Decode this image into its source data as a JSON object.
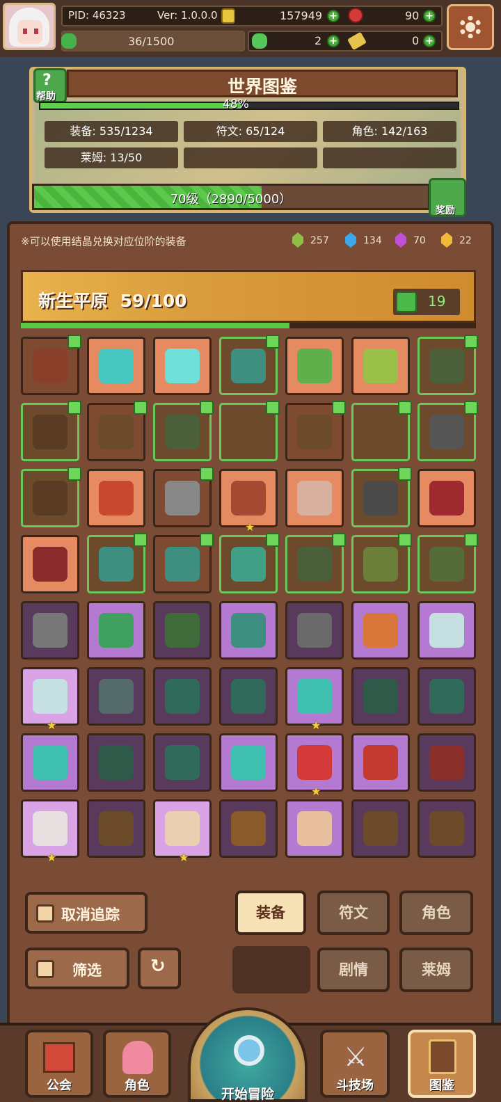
{
  "top": {
    "pid": "PID: 46323",
    "version": "Ver: 1.0.0.0",
    "gold": "157949",
    "gems": "90",
    "energy": "36/1500",
    "clover": "2",
    "ticket": "0"
  },
  "world": {
    "title": "世界图鉴",
    "help_label": "帮助",
    "percent_text": "48%",
    "percent_value": 0.48,
    "stats": [
      "装备: 535/1234",
      "符文: 65/124",
      "角色: 142/163",
      "莱姆: 13/50"
    ],
    "level_text": "70级（2890/5000）",
    "level_progress": 0.578,
    "reward_label": "奖励"
  },
  "hint": "※可以使用结晶兑换对应位阶的装备",
  "crystals": [
    {
      "name": "green-crystal",
      "color": "#8fbd45",
      "count": "257"
    },
    {
      "name": "blue-crystal",
      "color": "#3aa8ea",
      "count": "134"
    },
    {
      "name": "purple-crystal",
      "color": "#c04ed6",
      "count": "70"
    },
    {
      "name": "gold-crystal",
      "color": "#f2b83a",
      "count": "22"
    }
  ],
  "zone": {
    "name": "新生平原",
    "progress": "59/100",
    "progress_value": 0.59,
    "likes": "19"
  },
  "items": [
    {
      "tier": "brown",
      "color": "#8a3f2a",
      "thumb": true
    },
    {
      "tier": "orange",
      "color": "#47c7c0",
      "thumb": false
    },
    {
      "tier": "orange",
      "color": "#6fe0d8",
      "thumb": false
    },
    {
      "tier": "green",
      "color": "#3f8f80",
      "thumb": true
    },
    {
      "tier": "orange",
      "color": "#5fb04a",
      "thumb": false
    },
    {
      "tier": "orange",
      "color": "#9bc04a",
      "thumb": false
    },
    {
      "tier": "green",
      "color": "#4a5f3a",
      "thumb": true
    },
    {
      "tier": "green",
      "color": "#5a3c25",
      "thumb": true
    },
    {
      "tier": "brown",
      "color": "#6b4b2a",
      "thumb": true
    },
    {
      "tier": "green",
      "color": "#4a5f3a",
      "thumb": true
    },
    {
      "tier": "green",
      "color": "#6b4b2a",
      "thumb": true
    },
    {
      "tier": "brown",
      "color": "#6b4b2a",
      "thumb": true
    },
    {
      "tier": "green",
      "color": "#6b4b2a",
      "thumb": true
    },
    {
      "tier": "green",
      "color": "#555555",
      "thumb": true
    },
    {
      "tier": "green",
      "color": "#5a3c25",
      "thumb": true
    },
    {
      "tier": "orange",
      "color": "#c7472f",
      "thumb": false
    },
    {
      "tier": "brown",
      "color": "#888888",
      "thumb": true
    },
    {
      "tier": "orange",
      "color": "#a44a33",
      "thumb": false,
      "star": true
    },
    {
      "tier": "orange",
      "color": "#d8b0a0",
      "thumb": false
    },
    {
      "tier": "green",
      "color": "#4a4a4a",
      "thumb": true
    },
    {
      "tier": "orange",
      "color": "#9e2a30",
      "thumb": false
    },
    {
      "tier": "orange",
      "color": "#8a2a2a",
      "thumb": false
    },
    {
      "tier": "green",
      "color": "#3f8f80",
      "thumb": true
    },
    {
      "tier": "brown",
      "color": "#3f8f80",
      "thumb": true
    },
    {
      "tier": "green",
      "color": "#3fa087",
      "thumb": true
    },
    {
      "tier": "green",
      "color": "#4a5f3a",
      "thumb": true
    },
    {
      "tier": "green",
      "color": "#6b7f3a",
      "thumb": true
    },
    {
      "tier": "green",
      "color": "#556b3a",
      "thumb": true
    },
    {
      "tier": "purple",
      "color": "#777777",
      "thumb": false
    },
    {
      "tier": "lpurple",
      "color": "#3fa060",
      "thumb": false
    },
    {
      "tier": "purple",
      "color": "#3f6b3a",
      "thumb": false
    },
    {
      "tier": "lpurple",
      "color": "#3f8f80",
      "thumb": false
    },
    {
      "tier": "purple",
      "color": "#6a6a6a",
      "thumb": false
    },
    {
      "tier": "lpurple",
      "color": "#d9773a",
      "thumb": false
    },
    {
      "tier": "lpurple",
      "color": "#c6dfe0",
      "thumb": false
    },
    {
      "tier": "pink",
      "color": "#c6dfe0",
      "thumb": false,
      "star": true
    },
    {
      "tier": "purple",
      "color": "#556b6a",
      "thumb": false
    },
    {
      "tier": "purple",
      "color": "#2f6a5a",
      "thumb": false
    },
    {
      "tier": "purple",
      "color": "#2f6a5a",
      "thumb": false
    },
    {
      "tier": "lpurple",
      "color": "#3fc0b0",
      "thumb": false,
      "star": true
    },
    {
      "tier": "purple",
      "color": "#2f5a4a",
      "thumb": false
    },
    {
      "tier": "purple",
      "color": "#2f6a5a",
      "thumb": false
    },
    {
      "tier": "lpurple",
      "color": "#3fc0b0",
      "thumb": false
    },
    {
      "tier": "purple",
      "color": "#2f5a4a",
      "thumb": false
    },
    {
      "tier": "purple",
      "color": "#2f6a5a",
      "thumb": false
    },
    {
      "tier": "lpurple",
      "color": "#3fc0b0",
      "thumb": false
    },
    {
      "tier": "lpurple",
      "color": "#d53a3a",
      "thumb": false,
      "star": true
    },
    {
      "tier": "lpurple",
      "color": "#c23a30",
      "thumb": false
    },
    {
      "tier": "purple",
      "color": "#8a2f2a",
      "thumb": false
    },
    {
      "tier": "pink",
      "color": "#e8e0e0",
      "thumb": false,
      "star": true
    },
    {
      "tier": "purple",
      "color": "#6b4b2a",
      "thumb": false
    },
    {
      "tier": "pink",
      "color": "#e8d0b0",
      "thumb": false,
      "star": true
    },
    {
      "tier": "purple",
      "color": "#8a5a2a",
      "thumb": false
    },
    {
      "tier": "lpurple",
      "color": "#e8c0a0",
      "thumb": false
    },
    {
      "tier": "purple",
      "color": "#6b4b2a",
      "thumb": false
    },
    {
      "tier": "purple",
      "color": "#6b4b2a",
      "thumb": false
    }
  ],
  "controls": {
    "untrack": "取消追踪",
    "filter": "筛选",
    "tabs": {
      "equip": "装备",
      "rune": "符文",
      "role": "角色",
      "story": "剧情",
      "slime": "莱姆"
    }
  },
  "nav": {
    "guild": "公会",
    "role": "角色",
    "adventure": "开始冒险",
    "arena": "斗技场",
    "codex": "图鉴"
  }
}
